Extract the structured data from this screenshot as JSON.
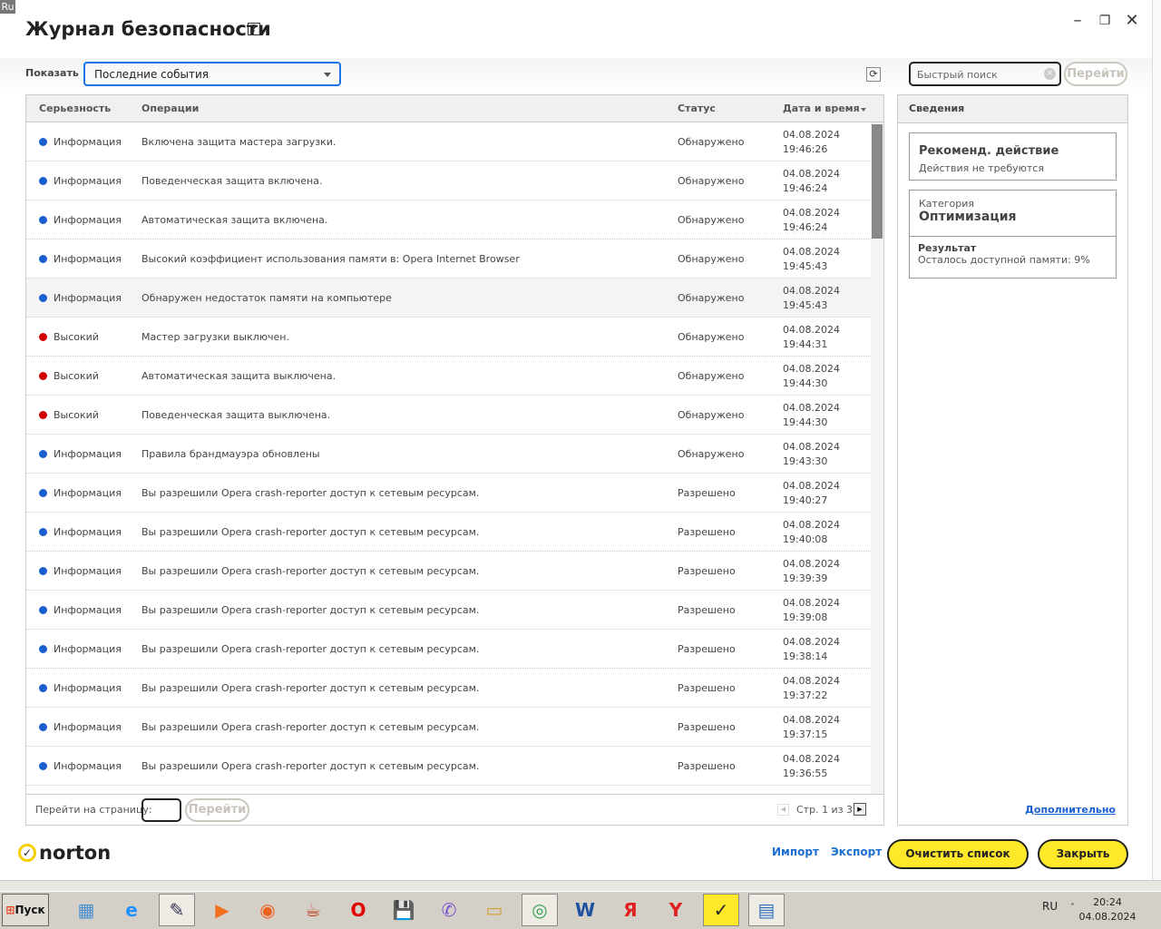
{
  "window": {
    "lang_tag": "Ru",
    "title": "Журнал безопасности",
    "help": "?",
    "minimize": "–",
    "restore": "❐",
    "close": "✕"
  },
  "toolbar": {
    "show_label": "Показать",
    "filter_value": "Последние события",
    "refresh": "⟳",
    "search_placeholder": "Быстрый поиск",
    "search_clear": "×",
    "search_go": "Перейти"
  },
  "table": {
    "headers": {
      "severity": "Серьезность",
      "operations": "Операции",
      "status": "Статус",
      "datetime": "Дата и время"
    },
    "rows": [
      {
        "severity": "Информация",
        "level": "info",
        "operation": "Включена защита мастера загрузки.",
        "status": "Обнаружено",
        "date": "04.08.2024",
        "time": "19:46:26"
      },
      {
        "severity": "Информация",
        "level": "info",
        "operation": "Поведенческая защита включена.",
        "status": "Обнаружено",
        "date": "04.08.2024",
        "time": "19:46:24"
      },
      {
        "severity": "Информация",
        "level": "info",
        "operation": "Автоматическая защита включена.",
        "status": "Обнаружено",
        "date": "04.08.2024",
        "time": "19:46:24"
      },
      {
        "severity": "Информация",
        "level": "info",
        "operation": "Высокий коэффициент использования памяти в: Opera Internet Browser",
        "status": "Обнаружено",
        "date": "04.08.2024",
        "time": "19:45:43"
      },
      {
        "severity": "Информация",
        "level": "info",
        "operation": "Обнаружен недостаток памяти на компьютере",
        "status": "Обнаружено",
        "date": "04.08.2024",
        "time": "19:45:43",
        "selected": true
      },
      {
        "severity": "Высокий",
        "level": "high",
        "operation": "Мастер загрузки выключен.",
        "status": "Обнаружено",
        "date": "04.08.2024",
        "time": "19:44:31"
      },
      {
        "severity": "Высокий",
        "level": "high",
        "operation": "Автоматическая защита выключена.",
        "status": "Обнаружено",
        "date": "04.08.2024",
        "time": "19:44:30"
      },
      {
        "severity": "Высокий",
        "level": "high",
        "operation": "Поведенческая защита выключена.",
        "status": "Обнаружено",
        "date": "04.08.2024",
        "time": "19:44:30"
      },
      {
        "severity": "Информация",
        "level": "info",
        "operation": "Правила брандмауэра обновлены",
        "status": "Обнаружено",
        "date": "04.08.2024",
        "time": "19:43:30"
      },
      {
        "severity": "Информация",
        "level": "info",
        "operation": "Вы разрешили Opera crash-reporter доступ к сетевым ресурсам.",
        "status": "Разрешено",
        "date": "04.08.2024",
        "time": "19:40:27"
      },
      {
        "severity": "Информация",
        "level": "info",
        "operation": "Вы разрешили Opera crash-reporter доступ к сетевым ресурсам.",
        "status": "Разрешено",
        "date": "04.08.2024",
        "time": "19:40:08"
      },
      {
        "severity": "Информация",
        "level": "info",
        "operation": "Вы разрешили Opera crash-reporter доступ к сетевым ресурсам.",
        "status": "Разрешено",
        "date": "04.08.2024",
        "time": "19:39:39"
      },
      {
        "severity": "Информация",
        "level": "info",
        "operation": "Вы разрешили Opera crash-reporter доступ к сетевым ресурсам.",
        "status": "Разрешено",
        "date": "04.08.2024",
        "time": "19:39:08"
      },
      {
        "severity": "Информация",
        "level": "info",
        "operation": "Вы разрешили Opera crash-reporter доступ к сетевым ресурсам.",
        "status": "Разрешено",
        "date": "04.08.2024",
        "time": "19:38:14"
      },
      {
        "severity": "Информация",
        "level": "info",
        "operation": "Вы разрешили Opera crash-reporter доступ к сетевым ресурсам.",
        "status": "Разрешено",
        "date": "04.08.2024",
        "time": "19:37:22"
      },
      {
        "severity": "Информация",
        "level": "info",
        "operation": "Вы разрешили Opera crash-reporter доступ к сетевым ресурсам.",
        "status": "Разрешено",
        "date": "04.08.2024",
        "time": "19:37:15"
      },
      {
        "severity": "Информация",
        "level": "info",
        "operation": "Вы разрешили Opera crash-reporter доступ к сетевым ресурсам.",
        "status": "Разрешено",
        "date": "04.08.2024",
        "time": "19:36:55"
      }
    ],
    "footer": {
      "goto_label": "Перейти на страницу:",
      "goto_button": "Перейти",
      "page_info": "Стр. 1 из 3"
    }
  },
  "colors": {
    "info": "#1a5fd0",
    "high": "#d00000",
    "accent": "#ffe82a"
  },
  "details": {
    "header": "Сведения",
    "action_title": "Рекоменд. действие",
    "action_text": "Действия не требуются",
    "category_label": "Категория",
    "category_value": "Оптимизация",
    "result_label": "Результат",
    "result_text": "Осталось доступной памяти: 9%",
    "more_link": "Дополнительно"
  },
  "footer": {
    "logo": "norton",
    "import": "Импорт",
    "export": "Экспорт",
    "clear": "Очистить список",
    "close": "Закрыть"
  },
  "taskbar": {
    "start": "Пуск",
    "lang": "RU",
    "time": "20:24",
    "date": "04.08.2024",
    "apps": [
      "calculator",
      "internet-explorer",
      "paint",
      "media-player",
      "firefox",
      "java",
      "opera",
      "save",
      "viber",
      "folder",
      "chrome",
      "word",
      "yandex",
      "yandex-browser",
      "norton",
      "control-panel"
    ]
  }
}
